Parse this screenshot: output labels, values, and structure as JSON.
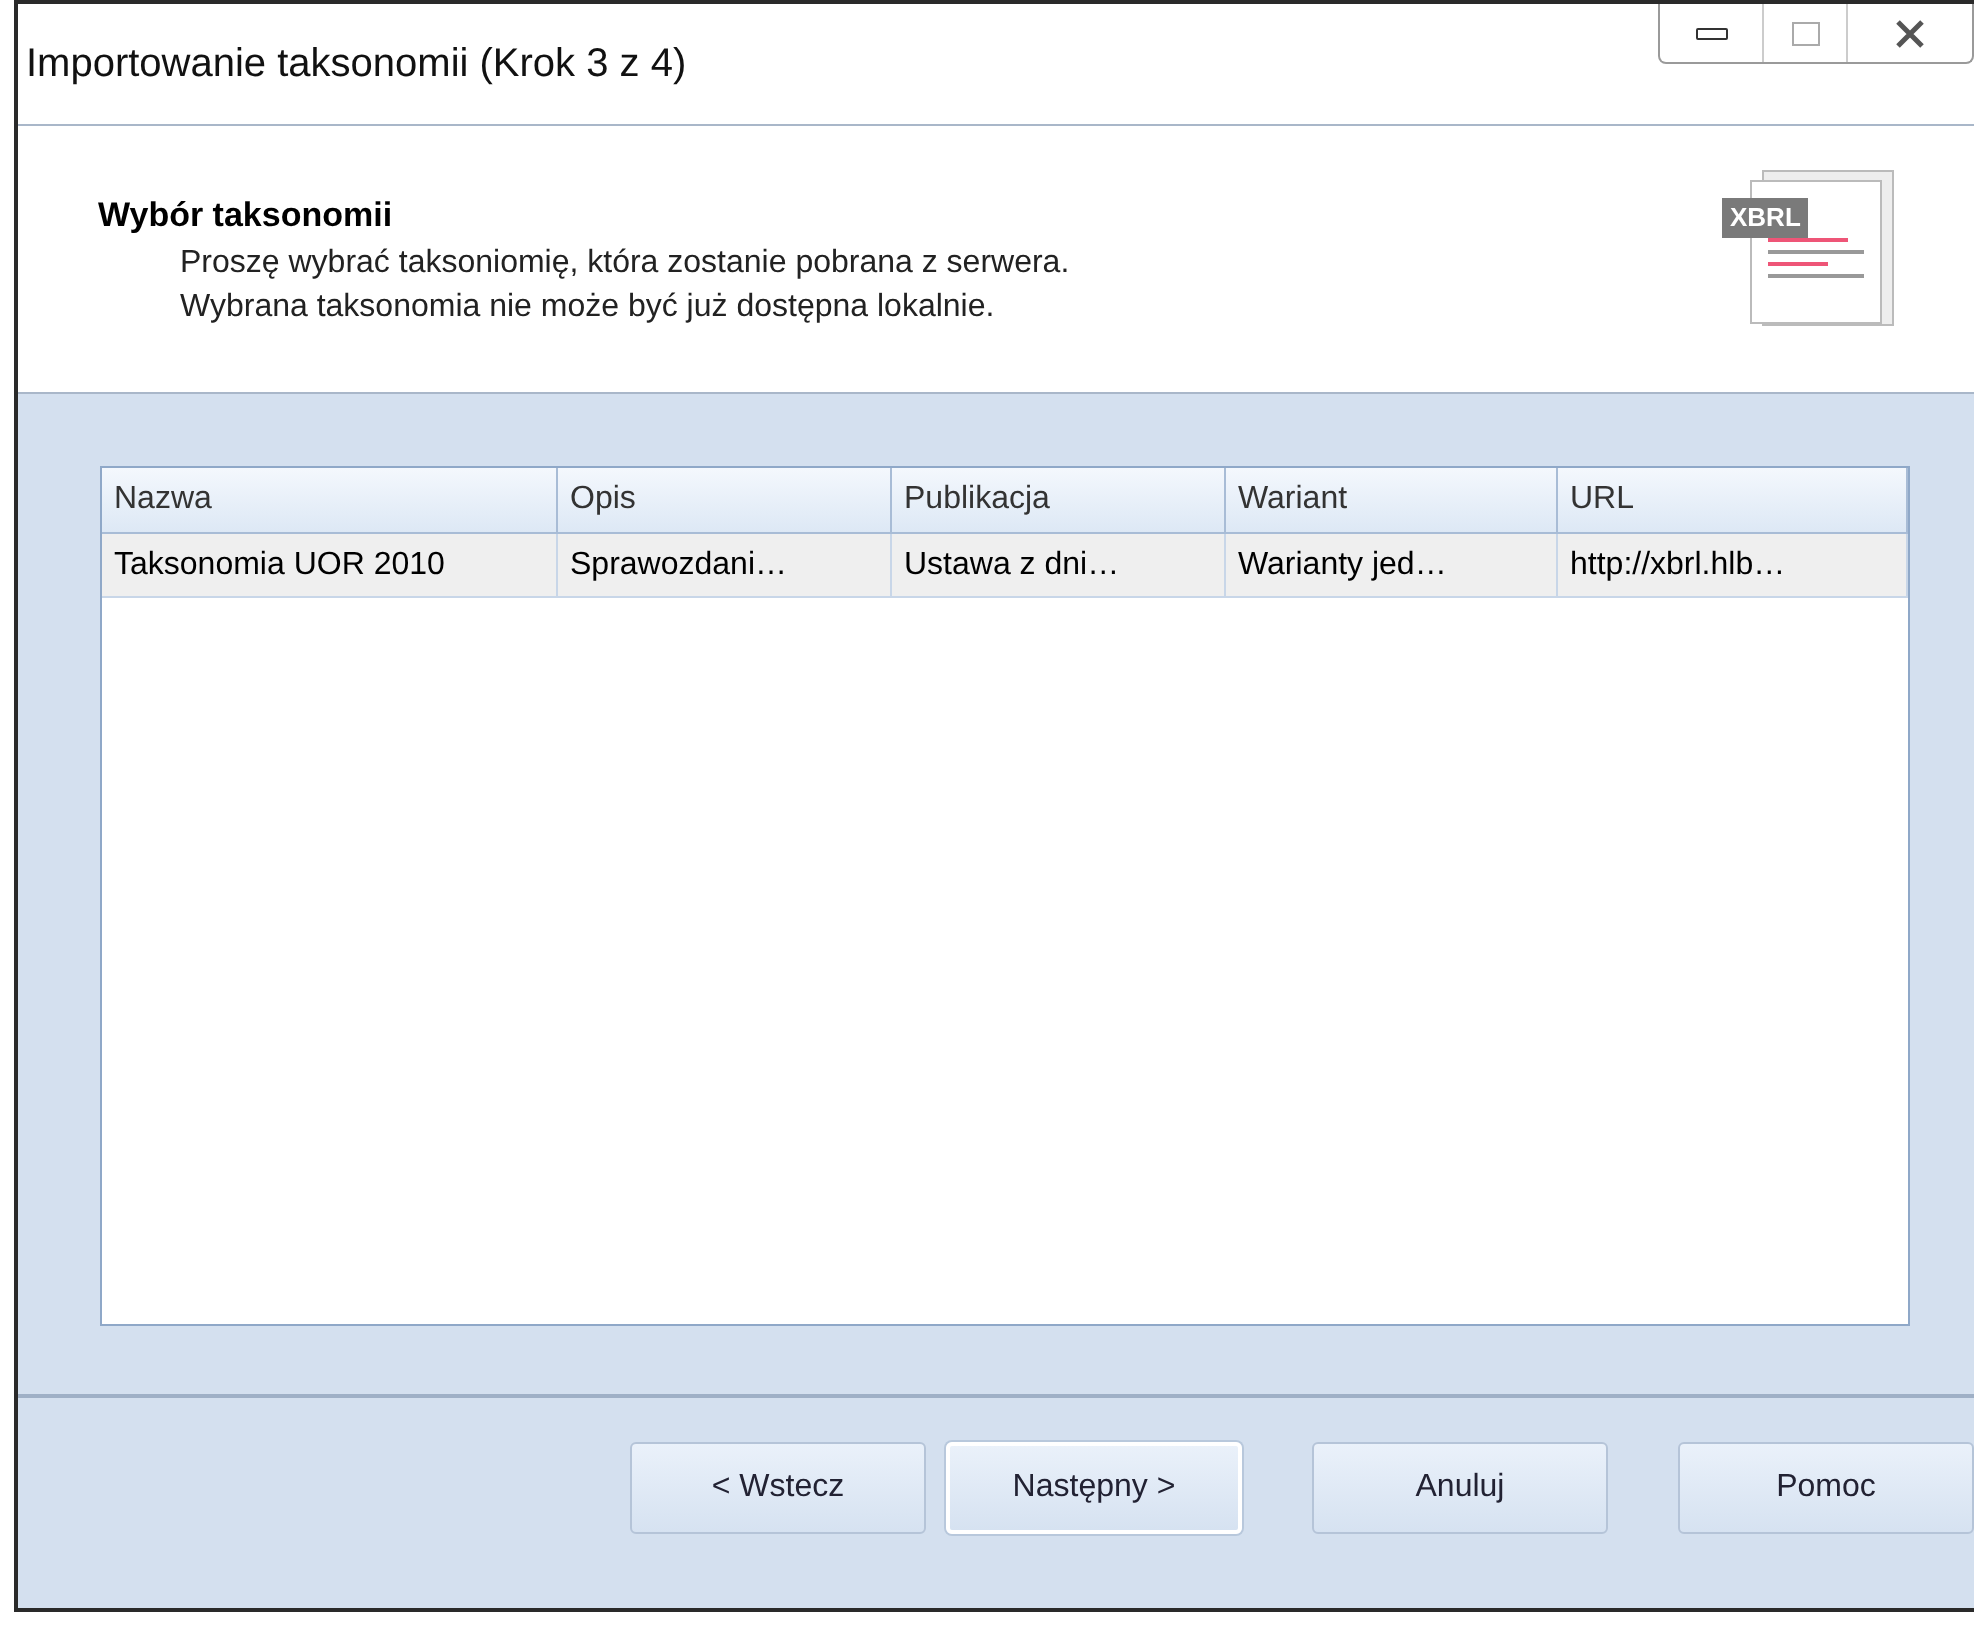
{
  "window": {
    "title": "Importowanie taksonomii (Krok 3 z 4)"
  },
  "header": {
    "title": "Wybór taksonomii",
    "lines": [
      "Proszę wybrać taksoniomię, która zostanie pobrana z serwera.",
      "Wybrana taksonomia nie może być już dostępna lokalnie."
    ],
    "badge": "XBRL"
  },
  "table": {
    "columns": [
      "Nazwa",
      "Opis",
      "Publikacja",
      "Wariant",
      "URL"
    ],
    "rows": [
      {
        "selected": true,
        "cells": [
          "Taksonomia UOR 2010",
          "Sprawozdani…",
          "Ustawa z dni…",
          "Warianty jed…",
          "http://xbrl.hlb…"
        ]
      }
    ]
  },
  "buttons": [
    {
      "label": "< Wstecz",
      "focused": false
    },
    {
      "label": "Następny >",
      "focused": true
    },
    {
      "label": "Anuluj",
      "focused": false
    },
    {
      "label": "Pomoc",
      "focused": false
    }
  ]
}
